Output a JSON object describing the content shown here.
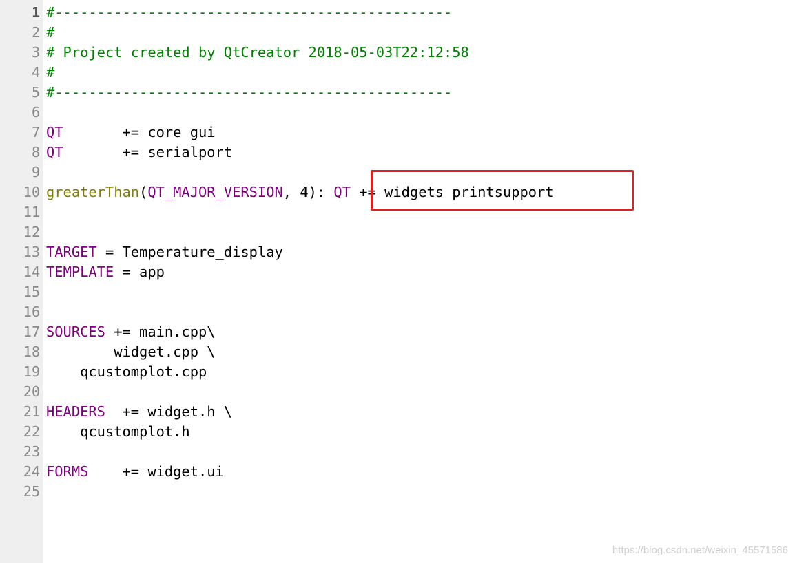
{
  "editor": {
    "current_line": "1",
    "lines": [
      {
        "num": "1",
        "parts": [
          {
            "t": "#-----------------------------------------------",
            "c": "comment"
          }
        ]
      },
      {
        "num": "2",
        "parts": [
          {
            "t": "#",
            "c": "comment"
          }
        ]
      },
      {
        "num": "3",
        "parts": [
          {
            "t": "# Project created by QtCreator 2018-05-03T22:12:58",
            "c": "comment"
          }
        ]
      },
      {
        "num": "4",
        "parts": [
          {
            "t": "#",
            "c": "comment"
          }
        ]
      },
      {
        "num": "5",
        "parts": [
          {
            "t": "#-----------------------------------------------",
            "c": "comment"
          }
        ]
      },
      {
        "num": "6",
        "parts": []
      },
      {
        "num": "7",
        "parts": [
          {
            "t": "QT",
            "c": "var"
          },
          {
            "t": "       += core gui",
            "c": ""
          }
        ]
      },
      {
        "num": "8",
        "parts": [
          {
            "t": "QT",
            "c": "var"
          },
          {
            "t": "       += serialport",
            "c": ""
          }
        ]
      },
      {
        "num": "9",
        "parts": []
      },
      {
        "num": "10",
        "parts": [
          {
            "t": "greaterThan",
            "c": "func"
          },
          {
            "t": "(",
            "c": ""
          },
          {
            "t": "QT_MAJOR_VERSION",
            "c": "arg"
          },
          {
            "t": ", 4): ",
            "c": ""
          },
          {
            "t": "QT",
            "c": "var"
          },
          {
            "t": " += widgets printsupport",
            "c": ""
          }
        ]
      },
      {
        "num": "11",
        "parts": []
      },
      {
        "num": "12",
        "parts": []
      },
      {
        "num": "13",
        "parts": [
          {
            "t": "TARGET",
            "c": "var"
          },
          {
            "t": " = Temperature_display",
            "c": ""
          }
        ]
      },
      {
        "num": "14",
        "parts": [
          {
            "t": "TEMPLATE",
            "c": "var"
          },
          {
            "t": " = app",
            "c": ""
          }
        ]
      },
      {
        "num": "15",
        "parts": []
      },
      {
        "num": "16",
        "parts": []
      },
      {
        "num": "17",
        "parts": [
          {
            "t": "SOURCES",
            "c": "var"
          },
          {
            "t": " += main.cpp\\",
            "c": ""
          }
        ]
      },
      {
        "num": "18",
        "parts": [
          {
            "t": "        widget.cpp \\",
            "c": ""
          }
        ]
      },
      {
        "num": "19",
        "parts": [
          {
            "t": "    qcustomplot.cpp",
            "c": ""
          }
        ]
      },
      {
        "num": "20",
        "parts": []
      },
      {
        "num": "21",
        "parts": [
          {
            "t": "HEADERS",
            "c": "var"
          },
          {
            "t": "  += widget.h \\",
            "c": ""
          }
        ]
      },
      {
        "num": "22",
        "parts": [
          {
            "t": "    qcustomplot.h",
            "c": ""
          }
        ]
      },
      {
        "num": "23",
        "parts": []
      },
      {
        "num": "24",
        "parts": [
          {
            "t": "FORMS",
            "c": "var"
          },
          {
            "t": "    += widget.ui",
            "c": ""
          }
        ]
      },
      {
        "num": "25",
        "parts": []
      }
    ]
  },
  "colors": {
    "comment": "#008000",
    "variable": "#800080",
    "function": "#808000",
    "annotation_box": "#e02020",
    "gutter_bg": "#efefef"
  },
  "watermark": "https://blog.csdn.net/weixin_45571586"
}
